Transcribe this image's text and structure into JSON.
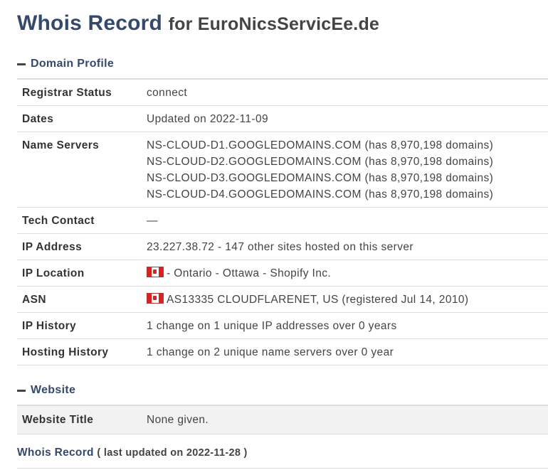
{
  "header": {
    "title": "Whois Record",
    "for_text": "for EuroNicsServicEe.de"
  },
  "domain_profile": {
    "heading": "Domain Profile",
    "rows": {
      "registrar_status": {
        "label": "Registrar Status",
        "value": "connect"
      },
      "dates": {
        "label": "Dates",
        "value": "Updated on 2022-11-09"
      },
      "name_servers": {
        "label": "Name Servers",
        "values": [
          "NS-CLOUD-D1.GOOGLEDOMAINS.COM (has 8,970,198 domains)",
          "NS-CLOUD-D2.GOOGLEDOMAINS.COM (has 8,970,198 domains)",
          "NS-CLOUD-D3.GOOGLEDOMAINS.COM (has 8,970,198 domains)",
          "NS-CLOUD-D4.GOOGLEDOMAINS.COM (has 8,970,198 domains)"
        ]
      },
      "tech_contact": {
        "label": "Tech Contact",
        "value": "—"
      },
      "ip_address": {
        "label": "IP Address",
        "value": "23.227.38.72 - 147 other sites hosted on this server"
      },
      "ip_location": {
        "label": "IP Location",
        "value": "- Ontario - Ottawa - Shopify Inc.",
        "flag": "canada-flag-icon"
      },
      "asn": {
        "label": "ASN",
        "value": "AS13335 CLOUDFLARENET, US (registered Jul 14, 2010)",
        "flag": "canada-flag-icon"
      },
      "ip_history": {
        "label": "IP History",
        "value": "1 change on 1 unique IP addresses over 0 years"
      },
      "hosting_history": {
        "label": "Hosting History",
        "value": "1 change on 2 unique name servers over 0 year"
      }
    }
  },
  "website": {
    "heading": "Website",
    "website_title": {
      "label": "Website Title",
      "value": "None given."
    }
  },
  "footer": {
    "link": "Whois Record",
    "updated": "( last updated on 2022-11-28 )"
  },
  "colors": {
    "heading": "#34496b",
    "border": "#dddddd",
    "flag_red": "#d9221e"
  }
}
